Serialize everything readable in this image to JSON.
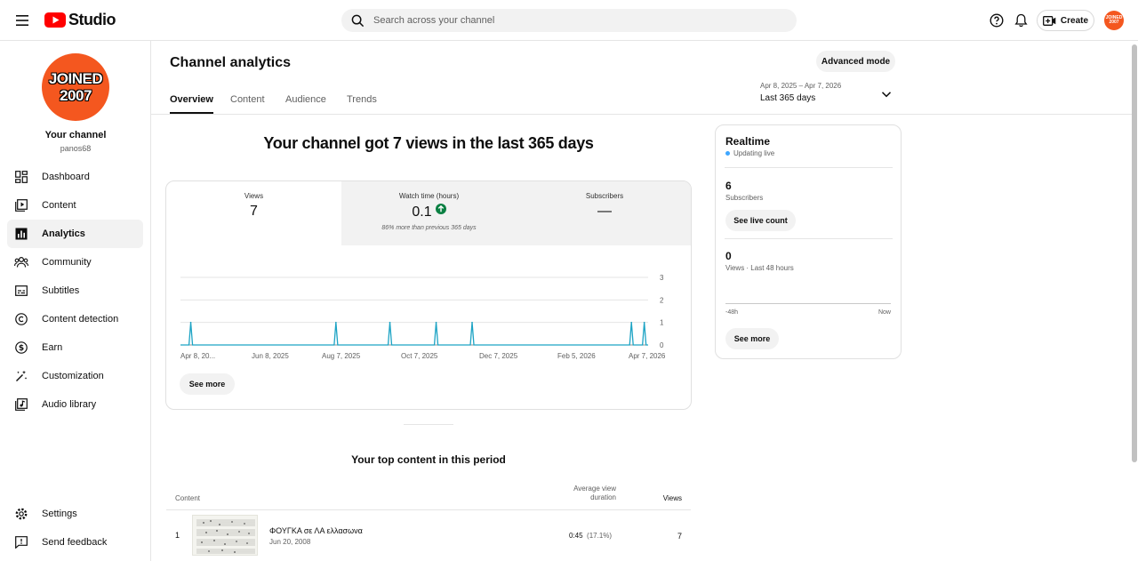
{
  "app": {
    "brand": "Studio",
    "avatar_text": [
      "JOINED",
      "2007"
    ]
  },
  "search": {
    "placeholder": "Search across your channel"
  },
  "header": {
    "create_label": "Create"
  },
  "sidebar": {
    "channel_label": "Your channel",
    "handle": "panos68",
    "items": [
      {
        "label": "Dashboard",
        "icon": "dashboard-icon"
      },
      {
        "label": "Content",
        "icon": "content-icon"
      },
      {
        "label": "Analytics",
        "icon": "analytics-icon",
        "active": true
      },
      {
        "label": "Community",
        "icon": "community-icon"
      },
      {
        "label": "Subtitles",
        "icon": "subtitles-icon"
      },
      {
        "label": "Content detection",
        "icon": "copyright-icon"
      },
      {
        "label": "Earn",
        "icon": "earn-icon"
      },
      {
        "label": "Customization",
        "icon": "customization-icon"
      },
      {
        "label": "Audio library",
        "icon": "audio-library-icon"
      }
    ],
    "bottom_items": [
      {
        "label": "Settings",
        "icon": "gear-icon"
      },
      {
        "label": "Send feedback",
        "icon": "feedback-icon"
      }
    ]
  },
  "page": {
    "title": "Channel analytics",
    "advanced_mode": "Advanced mode",
    "tabs": [
      "Overview",
      "Content",
      "Audience",
      "Trends"
    ],
    "date_range": "Apr 8, 2025 – Apr 7, 2026",
    "date_label": "Last 365 days",
    "headline": "Your channel got 7 views in the last 365 days"
  },
  "metrics": [
    {
      "label": "Views",
      "value": "7",
      "note": ""
    },
    {
      "label": "Watch time (hours)",
      "value": "0.1",
      "note": "86% more than previous 365 days",
      "trend": "up"
    },
    {
      "label": "Subscribers",
      "value": "—",
      "note": ""
    }
  ],
  "chart_data": {
    "type": "line",
    "x_ticks": [
      "Apr 8, 20...",
      "Jun 8, 2025",
      "Aug 7, 2025",
      "Oct 7, 2025",
      "Dec 7, 2025",
      "Feb 5, 2026",
      "Apr 7, 2026"
    ],
    "y_ticks": [
      "0",
      "1",
      "2",
      "3"
    ],
    "ylim": [
      0,
      3
    ],
    "grid": true,
    "series": [
      {
        "color": "#1ca3c4",
        "points": [
          {
            "x": "Apr 16, 2025",
            "y": 1
          },
          {
            "x": "Aug 7, 2025",
            "y": 1
          },
          {
            "x": "Sep 18, 2025",
            "y": 1
          },
          {
            "x": "Oct 24, 2025",
            "y": 1
          },
          {
            "x": "Nov 21, 2025",
            "y": 1
          },
          {
            "x": "Mar 25, 2026",
            "y": 1
          },
          {
            "x": "Apr 4, 2026",
            "y": 1
          }
        ]
      }
    ]
  },
  "overview": {
    "see_more": "See more"
  },
  "top_content": {
    "title": "Your top content in this period",
    "col_content": "Content",
    "col_avd_line1": "Average view",
    "col_avd_line2": "duration",
    "col_views": "Views",
    "rows": [
      {
        "rank": "1",
        "title": "ΦΟΥΓΚΑ σε ΛΑ ελλασωνα",
        "date": "Jun 20, 2008",
        "avd": "0:45",
        "avd_pct": "(17.1%)",
        "views": "7"
      }
    ]
  },
  "realtime": {
    "title": "Realtime",
    "status": "Updating live",
    "subscribers_value": "6",
    "subscribers_label": "Subscribers",
    "live_count_btn": "See live count",
    "views_value": "0",
    "views_label": "Views · Last 48 hours",
    "axis_start": "-48h",
    "axis_end": "Now",
    "see_more": "See more"
  }
}
